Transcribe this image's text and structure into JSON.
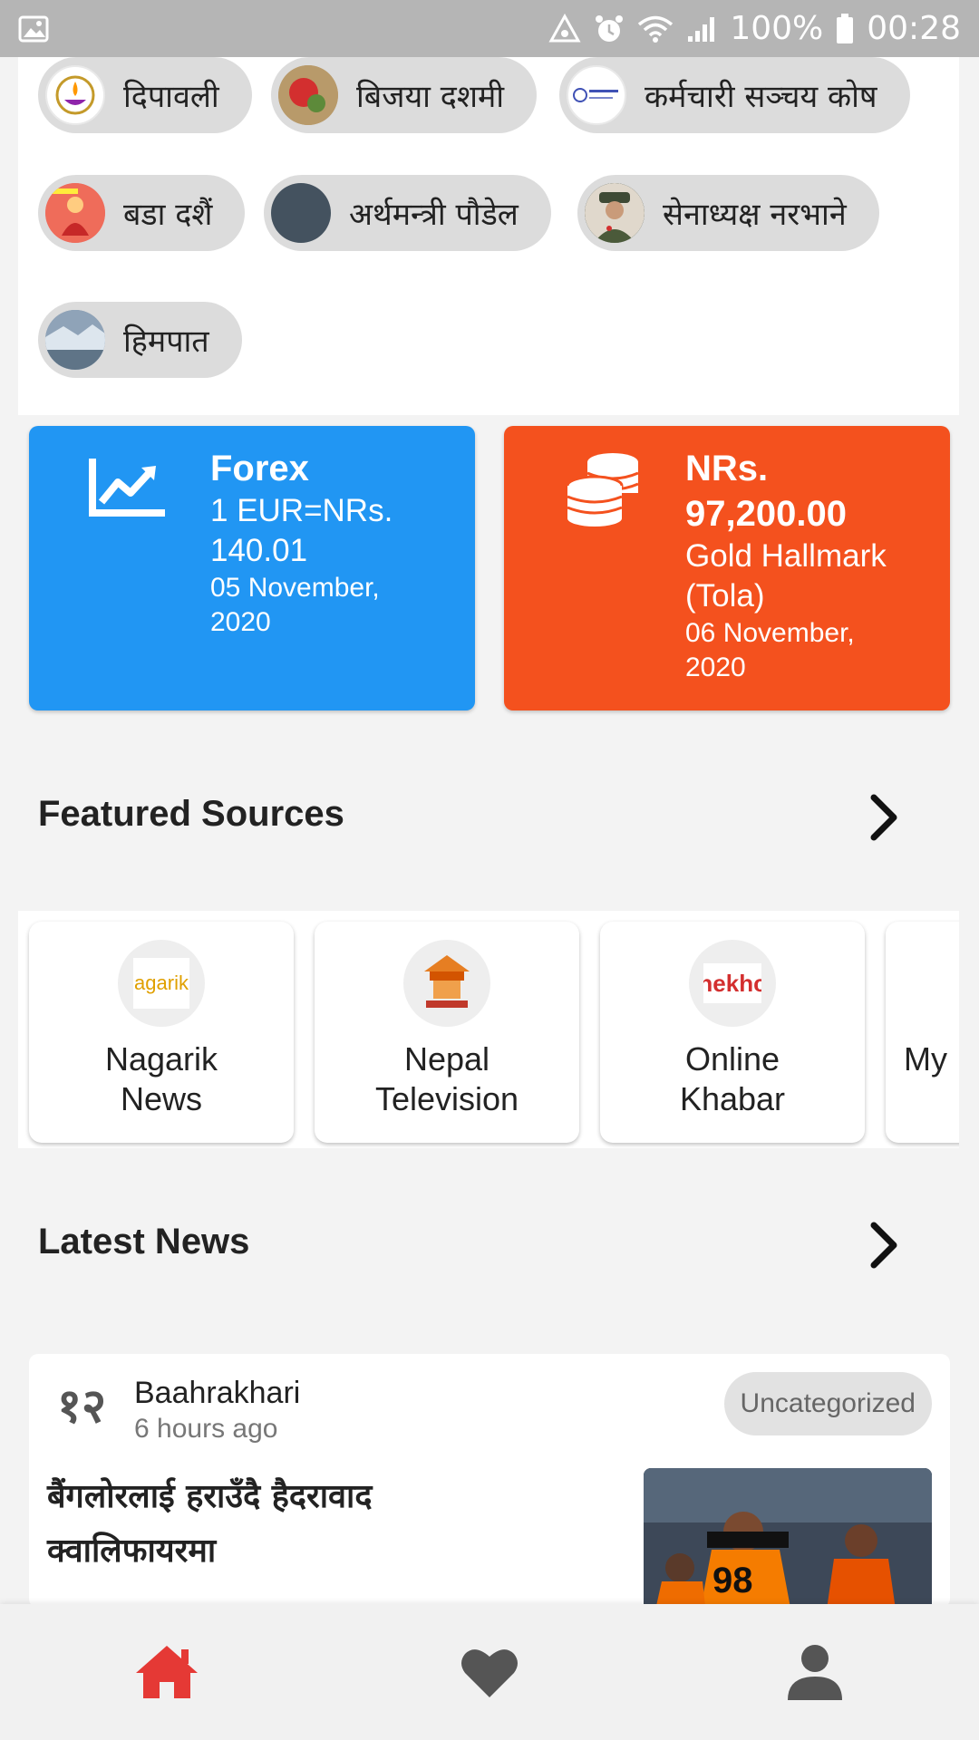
{
  "status_bar": {
    "battery": "100%",
    "time": "00:28"
  },
  "topics": [
    {
      "label": "दिपावली",
      "icon": "diya-lamp-icon"
    },
    {
      "label": "बिजया दशमी",
      "icon": "tika-plate-icon"
    },
    {
      "label": "कर्मचारी सञ्चय कोष",
      "icon": "employees-provident-fund-logo"
    },
    {
      "label": "बडा दशैं",
      "icon": "goddess-durga-icon"
    },
    {
      "label": "अर्थमन्त्री पौडेल",
      "icon": "avatar-placeholder"
    },
    {
      "label": "सेनाध्यक्ष नरभाने",
      "icon": "army-chief-photo"
    },
    {
      "label": "हिमपात",
      "icon": "snowfall-photo"
    }
  ],
  "forex": {
    "title": "Forex",
    "rate_line1": "1 EUR=NRs.",
    "rate_line2": "140.01",
    "date_line1": "05 November,",
    "date_line2": "2020",
    "color": "#2196f3",
    "icon": "trending-up-icon"
  },
  "gold": {
    "price_line1": "NRs.",
    "price_line2": "97,200.00",
    "label_line1": "Gold Hallmark",
    "label_line2": "(Tola)",
    "date_line1": "06 November,",
    "date_line2": "2020",
    "color": "#f4511e",
    "icon": "coins-stack-icon"
  },
  "featured_sources": {
    "title": "Featured Sources",
    "items": [
      {
        "line1": "Nagarik",
        "line2": "News",
        "logo_text": "agarik"
      },
      {
        "line1": "Nepal",
        "line2": "Television",
        "logo_text": ""
      },
      {
        "line1": "Online",
        "line2": "Khabar",
        "logo_text": "nekhc"
      },
      {
        "line1": "",
        "line2": "My",
        "logo_text": ""
      }
    ]
  },
  "latest_news": {
    "title": "Latest News",
    "article": {
      "source": "Baahrakhari",
      "source_logo_text": "१२",
      "time": "6 hours ago",
      "category": "Uncategorized",
      "headline_line1": "बैंगलोरलाई हराउँदै हैदरावाद",
      "headline_line2": "क्वालिफायरमा",
      "thumb_text": "98"
    }
  },
  "bottom_nav": {
    "items": [
      {
        "name": "home",
        "active": true
      },
      {
        "name": "favorites",
        "active": false
      },
      {
        "name": "profile",
        "active": false
      }
    ],
    "active_color": "#e53935",
    "inactive_color": "#555555"
  }
}
